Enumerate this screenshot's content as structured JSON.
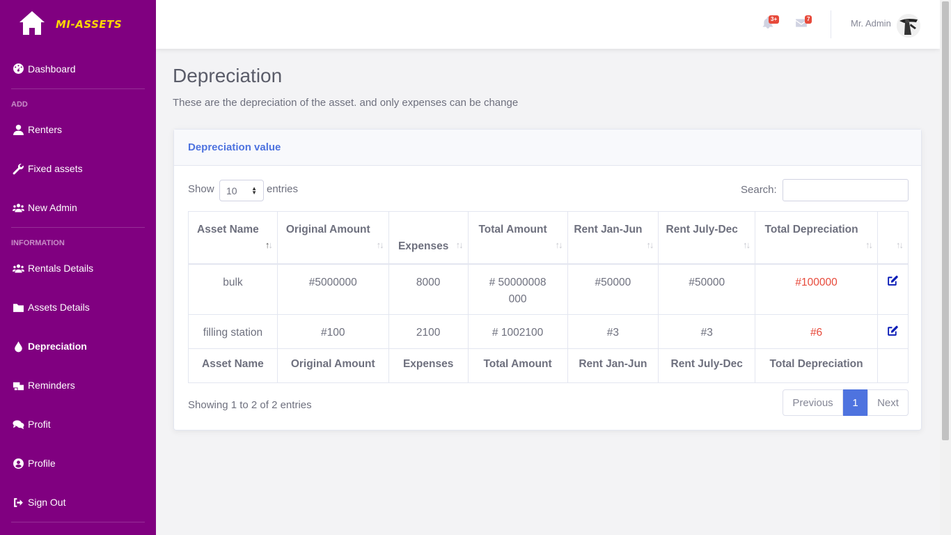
{
  "brand": {
    "name": "MI-ASSETS",
    "name_prefix": "MI-",
    "name_suffix": "ASSETS"
  },
  "sidebar": {
    "items": [
      {
        "label": "Dashboard",
        "icon": "dashboard-icon"
      },
      {
        "heading": "ADD"
      },
      {
        "label": "Renters",
        "icon": "user-icon"
      },
      {
        "label": "Fixed assets",
        "icon": "wrench-icon"
      },
      {
        "label": "New Admin",
        "icon": "users-icon"
      },
      {
        "heading": "INFORMATION"
      },
      {
        "label": "Rentals Details",
        "icon": "users-icon"
      },
      {
        "label": "Assets Details",
        "icon": "folder-icon"
      },
      {
        "label": "Depreciation",
        "icon": "droplet-icon",
        "active": true
      },
      {
        "label": "Reminders",
        "icon": "mailbox-icon"
      },
      {
        "label": "Profit",
        "icon": "comments-icon"
      },
      {
        "label": "Profile",
        "icon": "user-circle-icon"
      },
      {
        "label": "Sign Out",
        "icon": "sign-out-icon"
      }
    ]
  },
  "topbar": {
    "alerts_badge": "3+",
    "messages_badge": "7",
    "user_name": "Mr. Admin"
  },
  "page": {
    "title": "Depreciation",
    "subtitle": "These are the depreciation of the asset. and only expenses can be change"
  },
  "card": {
    "title": "Depreciation value",
    "show_label": "Show",
    "page_length": "10",
    "entries_label": "entries",
    "search_label": "Search:",
    "search_value": ""
  },
  "table": {
    "headers": [
      "Asset Name",
      "Original Amount",
      "Expenses",
      "Total Amount",
      "Rent Jan-Jun",
      "Rent July-Dec",
      "Total Depreciation",
      ""
    ],
    "rows": [
      [
        "bulk",
        "#5000000",
        "8000",
        "# 50000008000",
        "#50000",
        "#50000",
        "#100000"
      ],
      [
        "filling station",
        "#100",
        "2100",
        "# 1002100",
        "#3",
        "#3",
        "#6"
      ]
    ],
    "footers": [
      "Asset Name",
      "Original Amount",
      "Expenses",
      "Total Amount",
      "Rent Jan-Jun",
      "Rent July-Dec",
      "Total Depreciation",
      ""
    ]
  },
  "pagination": {
    "info": "Showing 1 to 2 of 2 entries",
    "previous": "Previous",
    "current": "1",
    "next": "Next"
  },
  "colors": {
    "sidebar": "#800080",
    "accent": "#4e73df",
    "danger": "#e74a3b",
    "brand_text": "#ffd700"
  }
}
